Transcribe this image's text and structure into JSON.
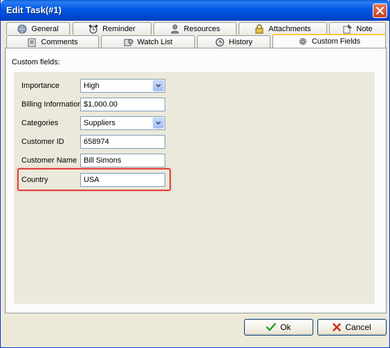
{
  "window": {
    "title": "Edit Task(#1)"
  },
  "tabs_row1": [
    {
      "label": "General",
      "icon": "globe-icon"
    },
    {
      "label": "Reminder",
      "icon": "alarm-clock-icon"
    },
    {
      "label": "Resources",
      "icon": "person-icon"
    },
    {
      "label": "Attachments",
      "icon": "lock-icon"
    },
    {
      "label": "Note",
      "icon": "note-pin-icon"
    }
  ],
  "tabs_row2": [
    {
      "label": "Comments",
      "icon": "comments-icon"
    },
    {
      "label": "Watch List",
      "icon": "watch-list-icon"
    },
    {
      "label": "History",
      "icon": "history-icon"
    },
    {
      "label": "Custom Fields",
      "icon": "gear-icon",
      "active": true
    }
  ],
  "panel": {
    "heading": "Custom fields:"
  },
  "fields": [
    {
      "label": "Importance",
      "value": "High",
      "type": "select"
    },
    {
      "label": "Billing Information",
      "value": "$1,000.00",
      "type": "text"
    },
    {
      "label": "Categories",
      "value": "Suppliers",
      "type": "select"
    },
    {
      "label": "Customer ID",
      "value": "658974",
      "type": "text"
    },
    {
      "label": "Customer Name",
      "value": "Bill Simons",
      "type": "text"
    },
    {
      "label": "Country",
      "value": "USA",
      "type": "text",
      "highlighted": true
    }
  ],
  "buttons": {
    "ok": "Ok",
    "cancel": "Cancel"
  },
  "colors": {
    "highlight": "#e0403a",
    "accent": "#0058e6",
    "ok_check": "#2f9e2f",
    "cancel_x": "#d42a1a"
  }
}
